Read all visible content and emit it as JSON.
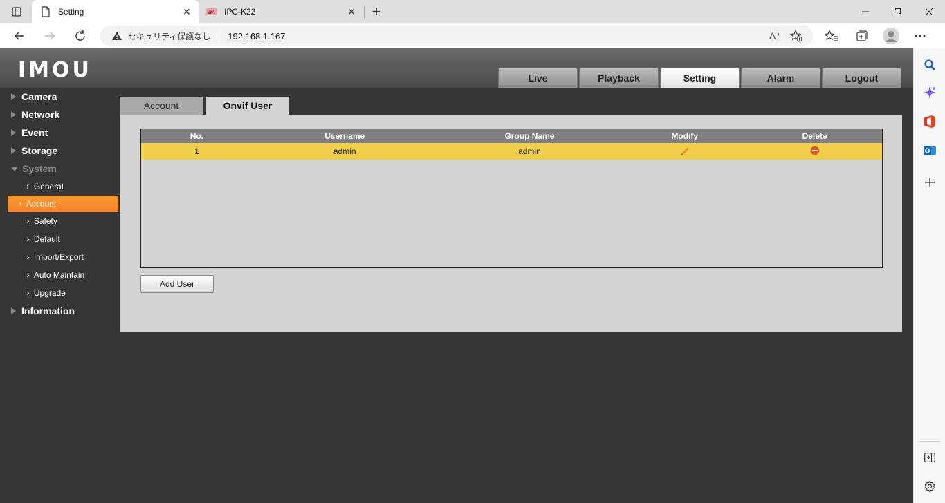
{
  "browser": {
    "tabs": [
      {
        "title": "Setting",
        "active": true
      },
      {
        "title": "IPC-K22",
        "active": false
      }
    ],
    "address": {
      "security_text": "セキュリティ保護なし",
      "url": "192.168.1.167"
    },
    "icons": {
      "read_aloud": "A)"
    }
  },
  "app": {
    "logo": "IMOU",
    "main_tabs": [
      "Live",
      "Playback",
      "Setting",
      "Alarm",
      "Logout"
    ],
    "active_main_tab": "Setting",
    "nav": {
      "camera": "Camera",
      "network": "Network",
      "event": "Event",
      "storage": "Storage",
      "system": "System",
      "system_items": [
        "General",
        "Account",
        "Safety",
        "Default",
        "Import/Export",
        "Auto Maintain",
        "Upgrade"
      ],
      "information": "Information"
    },
    "sub_tabs": [
      "Account",
      "Onvif User"
    ],
    "table": {
      "headers": [
        "No.",
        "Username",
        "Group Name",
        "Modify",
        "Delete"
      ],
      "rows": [
        {
          "no": "1",
          "username": "admin",
          "group": "admin"
        }
      ]
    },
    "add_user_label": "Add User",
    "colors": {
      "accent": "#f7822a",
      "row_selected": "#f0cf4a"
    }
  }
}
